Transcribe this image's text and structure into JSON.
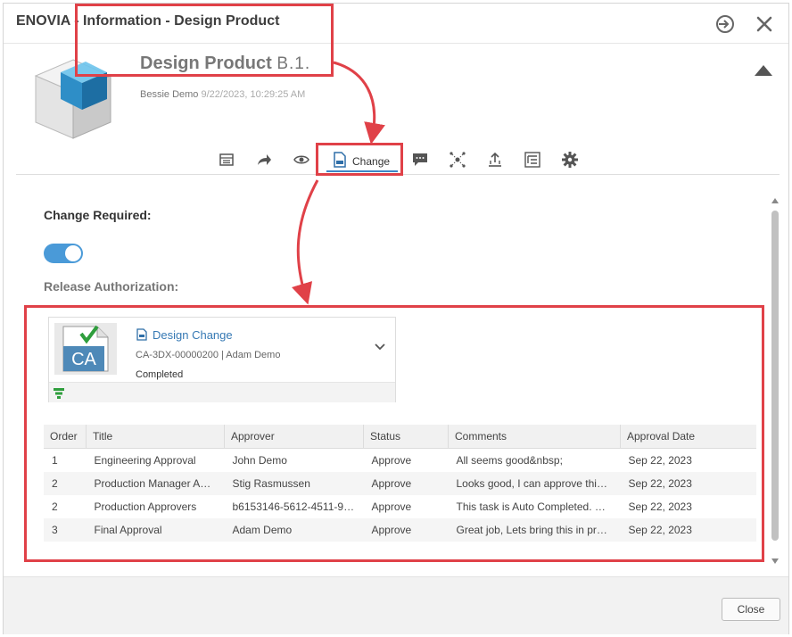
{
  "window": {
    "title": "ENOVIA - Information - Design Product"
  },
  "header": {
    "product_name": "Design Product",
    "revision": "B.1.",
    "owner": "Bessie Demo",
    "modified": "9/22/2023, 10:29:25 AM"
  },
  "toolbar": {
    "active_tab_label": "Change"
  },
  "change": {
    "required_label": "Change Required:",
    "required_on": true,
    "release_label": "Release Authorization:"
  },
  "card": {
    "name": "Design Change",
    "id_owner": "CA-3DX-00000200 | Adam Demo",
    "status": "Completed",
    "thumb_text": "CA"
  },
  "table": {
    "headers": [
      "Order",
      "Title",
      "Approver",
      "Status",
      "Comments",
      "Approval Date"
    ],
    "rows": [
      [
        "1",
        "Engineering Approval",
        "John Demo",
        "Approve",
        "All seems good&nbsp;",
        "Sep 22, 2023"
      ],
      [
        "2",
        "Production Manager App...",
        "Stig Rasmussen",
        "Approve",
        "Looks good, I can approve this....",
        "Sep 22, 2023"
      ],
      [
        "2",
        "Production Approvers",
        "b6153146-5612-4511-98...",
        "Approve",
        "This task is Auto Completed. No...",
        "Sep 22, 2023"
      ],
      [
        "3",
        "Final Approval",
        "Adam Demo",
        "Approve",
        "Great job, Lets bring this in prod...",
        "Sep 22, 2023"
      ]
    ]
  },
  "footer": {
    "close_label": "Close"
  },
  "colors": {
    "accent": "#3d86c6",
    "highlight": "#e04148",
    "toggle": "#4a9ad8",
    "link": "#3679b4"
  }
}
